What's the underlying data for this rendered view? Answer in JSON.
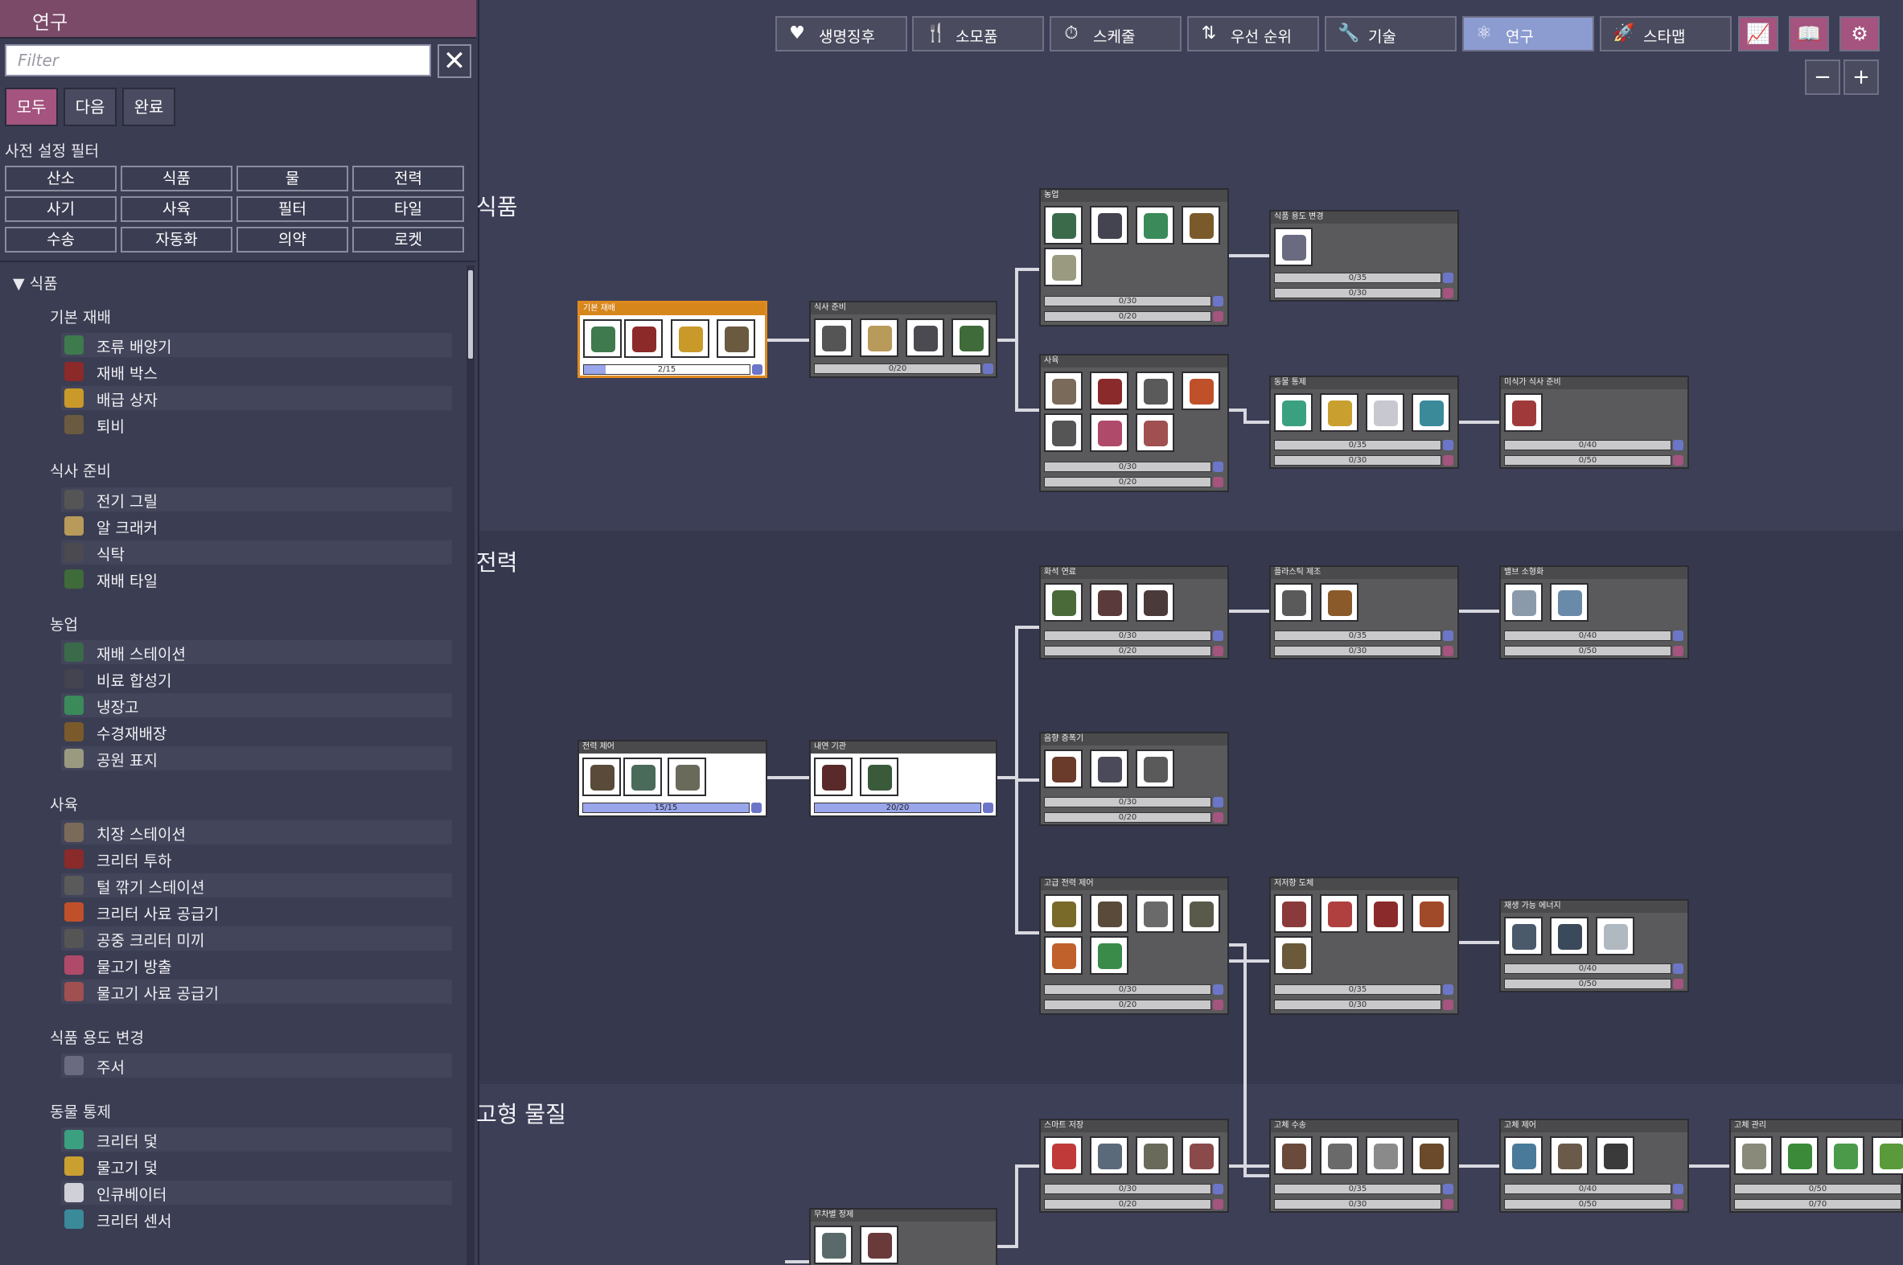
{
  "panel": {
    "title": "연구",
    "filter_placeholder": "Filter",
    "filter_buttons": [
      "모두",
      "다음",
      "완료"
    ],
    "preset_label": "사전 설정 필터",
    "presets": [
      "산소",
      "식품",
      "물",
      "전력",
      "사기",
      "사육",
      "필터",
      "타일",
      "수송",
      "자동화",
      "의약",
      "로켓"
    ],
    "list": {
      "category": "▼ 식품",
      "groups": [
        {
          "title": "기본 재배",
          "items": [
            "조류 배양기",
            "재배 박스",
            "배급 상자",
            "퇴비"
          ]
        },
        {
          "title": "식사 준비",
          "items": [
            "전기 그릴",
            "알 크래커",
            "식탁",
            "재배 타일"
          ]
        },
        {
          "title": "농업",
          "items": [
            "재배 스테이션",
            "비료 합성기",
            "냉장고",
            "수경재배장",
            "공원 표지"
          ]
        },
        {
          "title": "사육",
          "items": [
            "치장 스테이션",
            "크리터 투하",
            "털 깎기 스테이션",
            "크리터 사료 공급기",
            "공중 크리터 미끼",
            "물고기 방출",
            "물고기 사료 공급기"
          ]
        },
        {
          "title": "식품 용도 변경",
          "items": [
            "주서"
          ]
        },
        {
          "title": "동물 통제",
          "items": [
            "크리터 덫",
            "물고기 덫",
            "인큐베이터",
            "크리터 센서"
          ]
        }
      ]
    }
  },
  "topbar": {
    "tabs": [
      {
        "label": "생명징후",
        "icon": "♥"
      },
      {
        "label": "소모품",
        "icon": "🍴"
      },
      {
        "label": "스케줄",
        "icon": "⏱"
      },
      {
        "label": "우선 순위",
        "icon": "⇅"
      },
      {
        "label": "기술",
        "icon": "🔧"
      },
      {
        "label": "연구",
        "icon": "⚛"
      },
      {
        "label": "스타맵",
        "icon": "🚀"
      }
    ],
    "icon_buttons": [
      "📈",
      "📖",
      "⚙"
    ],
    "zoom_out": "−",
    "zoom_in": "+"
  },
  "tree": {
    "categories": [
      "식품",
      "전력",
      "고형 물질"
    ],
    "nodes": [
      {
        "title": "기본 재배",
        "state": "current",
        "progress": "2/15",
        "fraction": 0.13
      },
      {
        "title": "식사 준비",
        "progress": "0/20"
      },
      {
        "title": "농업",
        "bars": [
          "0/30",
          "0/20"
        ]
      },
      {
        "title": "식품 용도 변경",
        "bars": [
          "0/35",
          "0/30"
        ]
      },
      {
        "title": "사육",
        "bars": [
          "0/30",
          "0/20"
        ]
      },
      {
        "title": "동물 통제",
        "bars": [
          "0/35",
          "0/30"
        ]
      },
      {
        "title": "미식가 식사 준비",
        "bars": [
          "0/40",
          "0/50"
        ]
      },
      {
        "title": "화석 연료",
        "bars": [
          "0/30",
          "0/20"
        ]
      },
      {
        "title": "플라스틱 제조",
        "bars": [
          "0/35",
          "0/30"
        ]
      },
      {
        "title": "밸브 소형화",
        "bars": [
          "0/40",
          "0/50"
        ]
      },
      {
        "title": "전력 제어",
        "state": "done",
        "progress": "15/15"
      },
      {
        "title": "내연 기관",
        "state": "done",
        "progress": "20/20"
      },
      {
        "title": "음향 증폭기",
        "bars": [
          "0/30",
          "0/20"
        ]
      },
      {
        "title": "고급 전력 제어",
        "bars": [
          "0/30",
          "0/20"
        ]
      },
      {
        "title": "저저항 도체",
        "bars": [
          "0/35",
          "0/30"
        ]
      },
      {
        "title": "재생 가능 에너지",
        "bars": [
          "0/40",
          "0/50"
        ]
      },
      {
        "title": "스마트 저장",
        "bars": [
          "0/30",
          "0/20"
        ]
      },
      {
        "title": "고체 수송",
        "bars": [
          "0/35",
          "0/30"
        ]
      },
      {
        "title": "고체 제어",
        "bars": [
          "0/40",
          "0/50"
        ]
      },
      {
        "title": "고체 관리",
        "bars": [
          "0/50",
          "0/70"
        ]
      },
      {
        "title": "무차별 정제"
      }
    ]
  }
}
